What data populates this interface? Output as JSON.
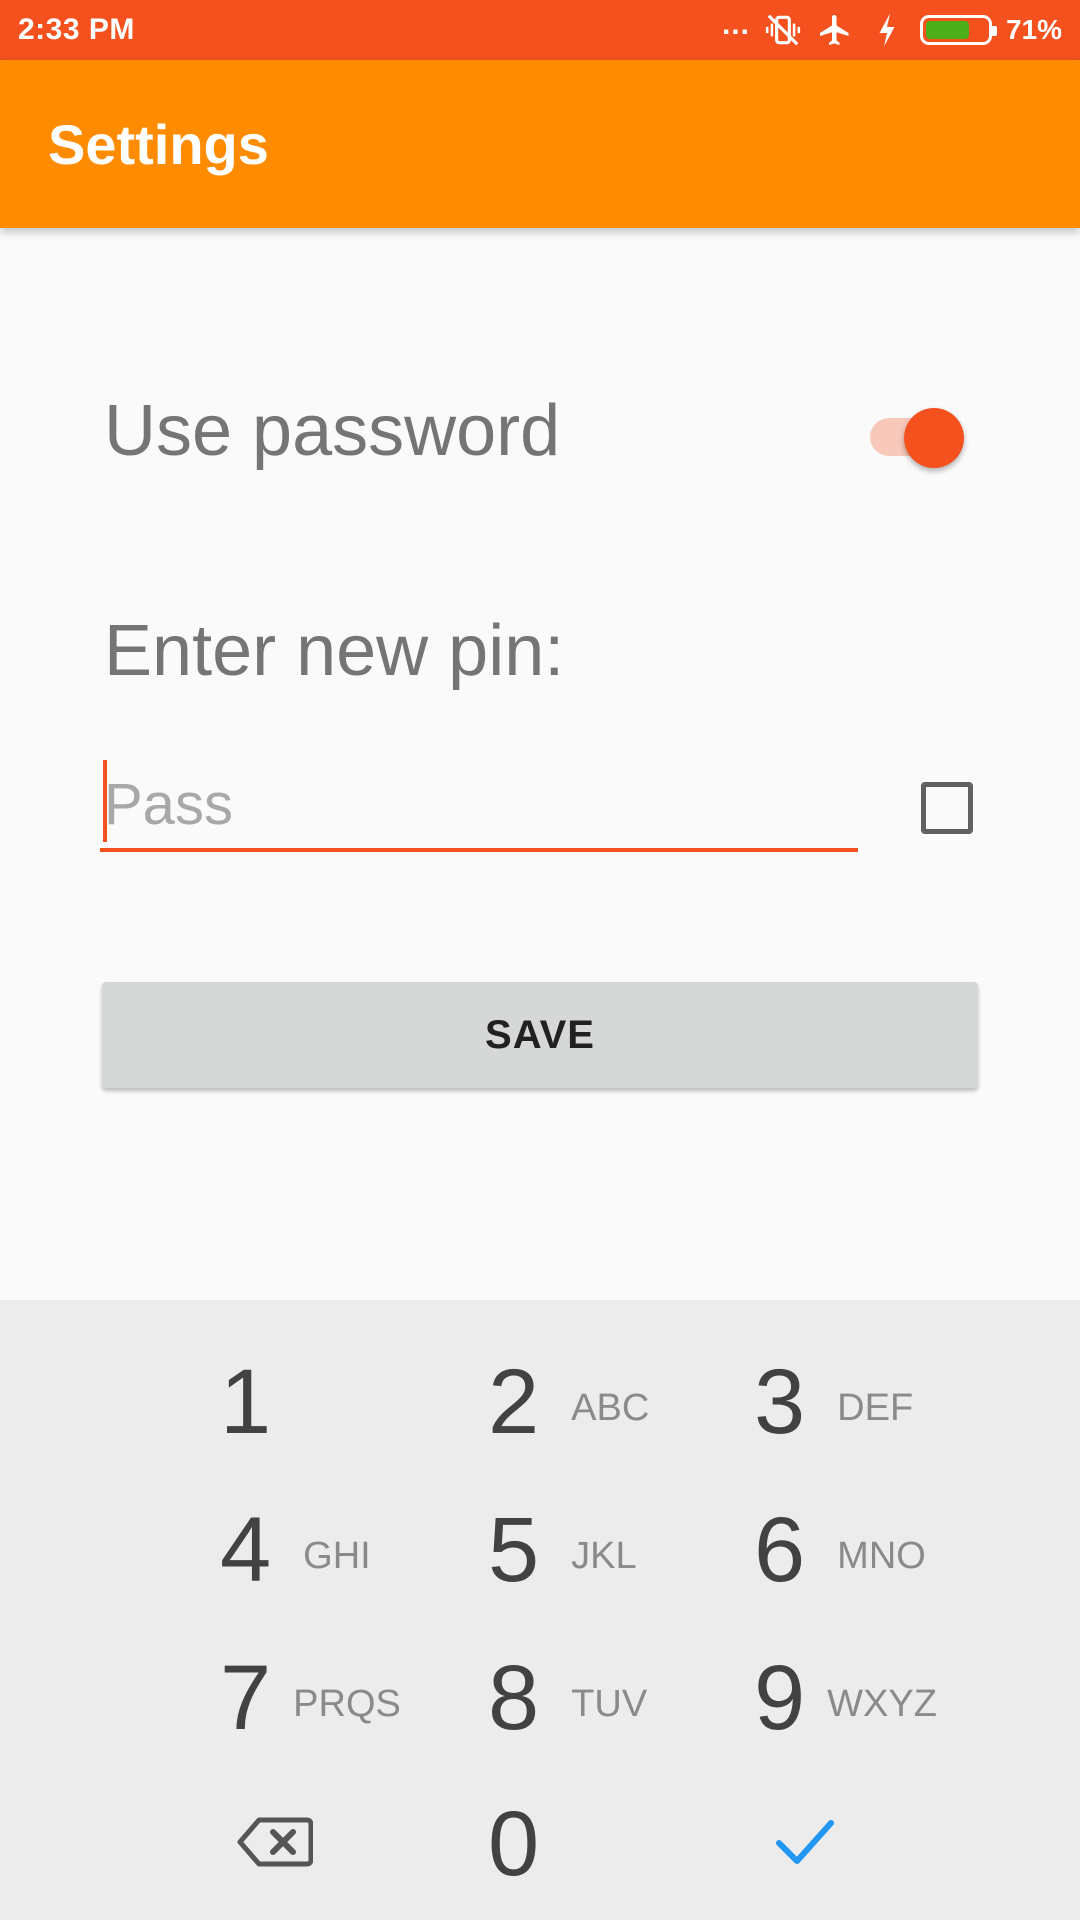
{
  "status_bar": {
    "time": "2:33 PM",
    "dots": "...",
    "icons": [
      "vibrate-off-icon",
      "airplane-icon",
      "charging-icon",
      "battery-icon"
    ],
    "battery_level": 0.71,
    "battery_percent": "71%"
  },
  "app_bar": {
    "title": "Settings"
  },
  "settings": {
    "use_password_label": "Use password",
    "use_password_on": true,
    "enter_pin_label": "Enter new pin:",
    "pin_placeholder": "Pass",
    "show_pin_checked": false,
    "save_label": "SAVE"
  },
  "keyboard": {
    "keys": [
      {
        "num": "1",
        "letters": ""
      },
      {
        "num": "2",
        "letters": "ABC"
      },
      {
        "num": "3",
        "letters": "DEF"
      },
      {
        "num": "4",
        "letters": "GHI"
      },
      {
        "num": "5",
        "letters": "JKL"
      },
      {
        "num": "6",
        "letters": "MNO"
      },
      {
        "num": "7",
        "letters": "PRQS"
      },
      {
        "num": "8",
        "letters": "TUV"
      },
      {
        "num": "9",
        "letters": "WXYZ"
      },
      {
        "num": "0",
        "letters": ""
      }
    ],
    "backspace_icon": "backspace-icon",
    "done_icon": "checkmark-icon"
  },
  "colors": {
    "status_bar": "#f4511e",
    "app_bar": "#ff8c00",
    "accent": "#f4511e",
    "done_check": "#2196f3"
  }
}
